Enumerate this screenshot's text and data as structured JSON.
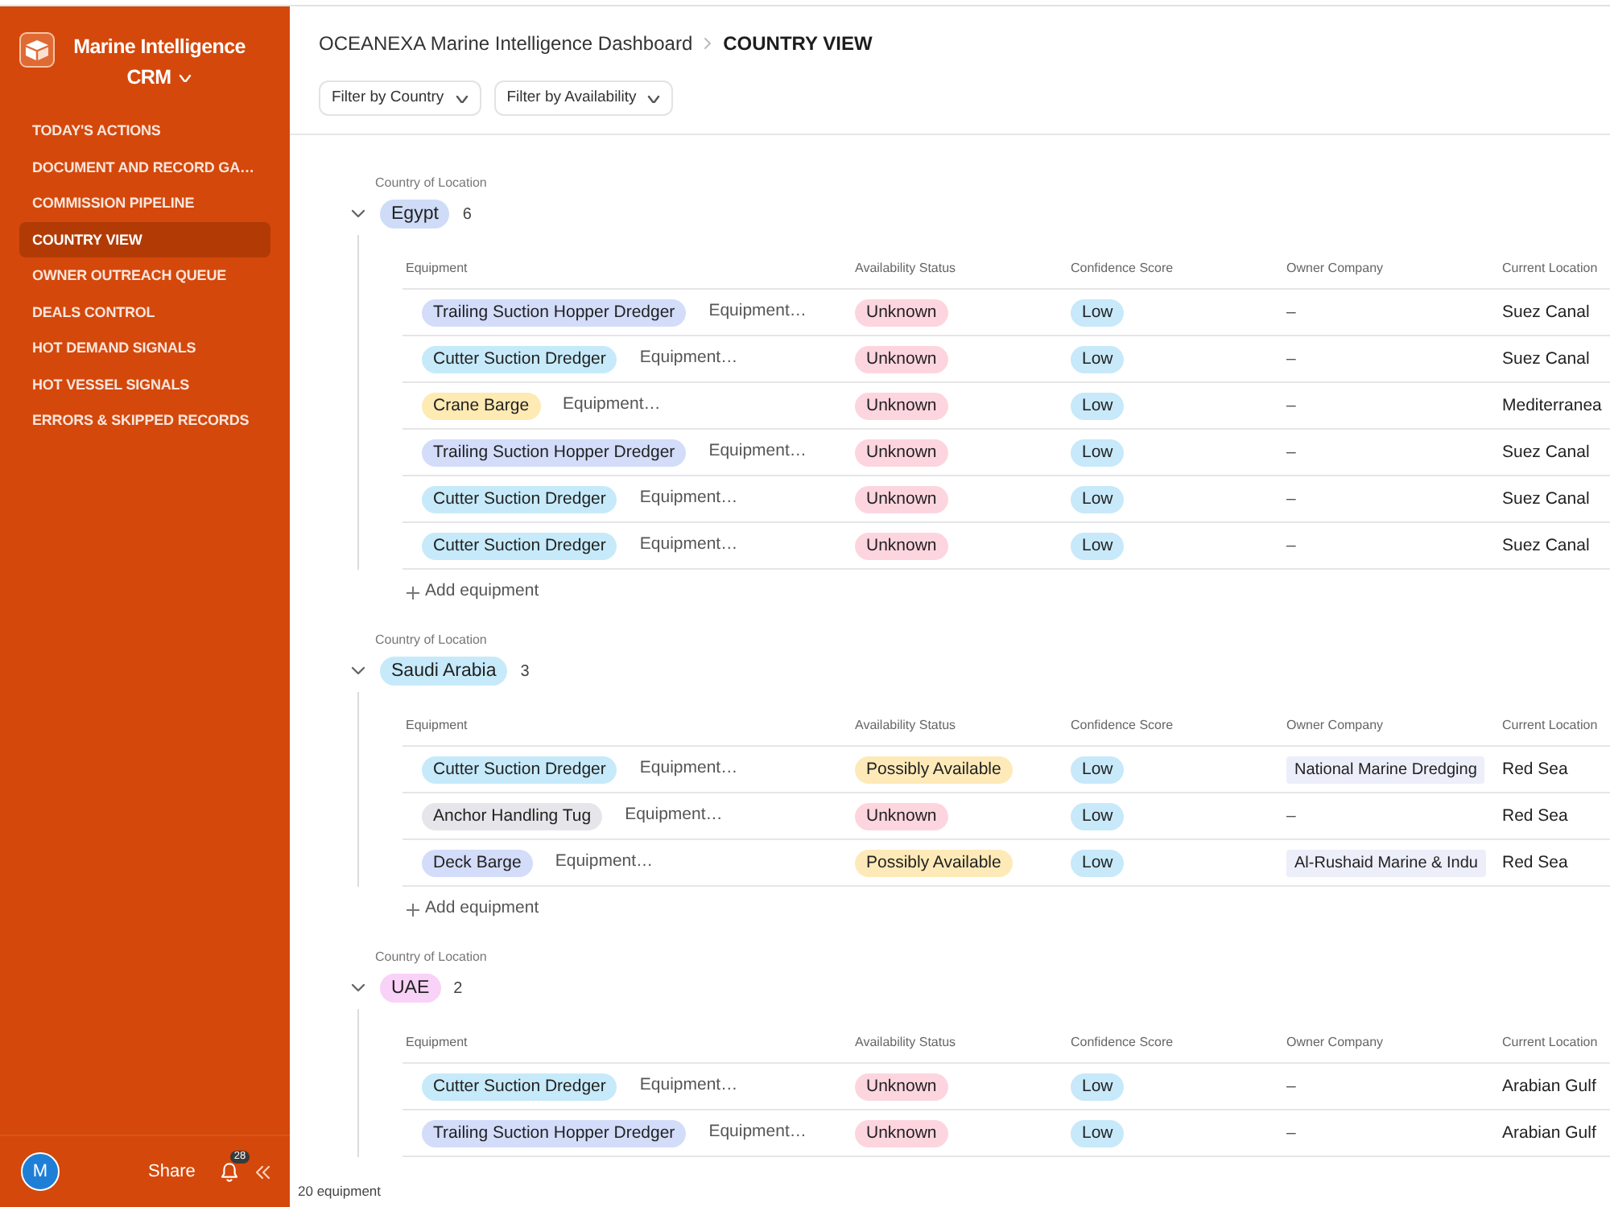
{
  "sidebar": {
    "app_title": "Marine Intelligence",
    "app_subtitle": "CRM",
    "items": [
      {
        "label": "TODAY'S ACTIONS",
        "selected": false
      },
      {
        "label": "DOCUMENT AND RECORD GA…",
        "selected": false
      },
      {
        "label": "COMMISSION PIPELINE",
        "selected": false
      },
      {
        "label": "COUNTRY VIEW",
        "selected": true
      },
      {
        "label": "OWNER OUTREACH QUEUE",
        "selected": false
      },
      {
        "label": "DEALS CONTROL",
        "selected": false
      },
      {
        "label": "HOT DEMAND SIGNALS",
        "selected": false
      },
      {
        "label": "HOT VESSEL SIGNALS",
        "selected": false
      },
      {
        "label": "ERRORS & SKIPPED RECORDS",
        "selected": false
      }
    ],
    "footer": {
      "avatar_initial": "M",
      "share_label": "Share",
      "notification_count": "28"
    }
  },
  "header": {
    "breadcrumb": [
      "OCEANEXA Marine Intelligence Dashboard",
      "COUNTRY VIEW"
    ],
    "filters": [
      "Filter by Country",
      "Filter by Availability"
    ]
  },
  "groups": [
    {
      "field_label": "Country of Location",
      "country": {
        "label": "Egypt",
        "color": "#cfdcf7"
      },
      "count": "6",
      "expanded": true,
      "columns": [
        "Equipment",
        "Availability Status",
        "Confidence Score",
        "Owner Company",
        "Current Location"
      ],
      "rows": [
        {
          "equipment_type": {
            "label": "Trailing Suction Hopper Dredger",
            "color": "#d3ddfa"
          },
          "equipment": "Equipment…",
          "availability": {
            "label": "Unknown",
            "color": "#fdd5df"
          },
          "confidence": {
            "label": "Low",
            "color": "#c7e9fa"
          },
          "owner_company": {
            "text": "–",
            "kind": "empty"
          },
          "current_location": "Suez Canal"
        },
        {
          "equipment_type": {
            "label": "Cutter Suction Dredger",
            "color": "#c6eafa"
          },
          "equipment": "Equipment…",
          "availability": {
            "label": "Unknown",
            "color": "#fdd5df"
          },
          "confidence": {
            "label": "Low",
            "color": "#c7e9fa"
          },
          "owner_company": {
            "text": "–",
            "kind": "empty"
          },
          "current_location": "Suez Canal"
        },
        {
          "equipment_type": {
            "label": "Crane Barge",
            "color": "#feeab3"
          },
          "equipment": "Equipment…",
          "availability": {
            "label": "Unknown",
            "color": "#fdd5df"
          },
          "confidence": {
            "label": "Low",
            "color": "#c7e9fa"
          },
          "owner_company": {
            "text": "–",
            "kind": "empty"
          },
          "current_location": "Mediterranea"
        },
        {
          "equipment_type": {
            "label": "Trailing Suction Hopper Dredger",
            "color": "#d3ddfa"
          },
          "equipment": "Equipment…",
          "availability": {
            "label": "Unknown",
            "color": "#fdd5df"
          },
          "confidence": {
            "label": "Low",
            "color": "#c7e9fa"
          },
          "owner_company": {
            "text": "–",
            "kind": "empty"
          },
          "current_location": "Suez Canal"
        },
        {
          "equipment_type": {
            "label": "Cutter Suction Dredger",
            "color": "#c6eafa"
          },
          "equipment": "Equipment…",
          "availability": {
            "label": "Unknown",
            "color": "#fdd5df"
          },
          "confidence": {
            "label": "Low",
            "color": "#c7e9fa"
          },
          "owner_company": {
            "text": "–",
            "kind": "empty"
          },
          "current_location": "Suez Canal"
        },
        {
          "equipment_type": {
            "label": "Cutter Suction Dredger",
            "color": "#c6eafa"
          },
          "equipment": "Equipment…",
          "availability": {
            "label": "Unknown",
            "color": "#fdd5df"
          },
          "confidence": {
            "label": "Low",
            "color": "#c7e9fa"
          },
          "owner_company": {
            "text": "–",
            "kind": "empty"
          },
          "current_location": "Suez Canal"
        }
      ],
      "add_label": "Add equipment"
    },
    {
      "field_label": "Country of Location",
      "country": {
        "label": "Saudi Arabia",
        "color": "#c6eafa"
      },
      "count": "3",
      "expanded": true,
      "columns": [
        "Equipment",
        "Availability Status",
        "Confidence Score",
        "Owner Company",
        "Current Location"
      ],
      "rows": [
        {
          "equipment_type": {
            "label": "Cutter Suction Dredger",
            "color": "#c6eafa"
          },
          "equipment": "Equipment…",
          "availability": {
            "label": "Possibly Available",
            "color": "#feeab8"
          },
          "confidence": {
            "label": "Low",
            "color": "#c7e9fa"
          },
          "owner_company": {
            "text": "National Marine Dredging",
            "kind": "link"
          },
          "current_location": "Red Sea"
        },
        {
          "equipment_type": {
            "label": "Anchor Handling Tug",
            "color": "#e6e6ea"
          },
          "equipment": "Equipment…",
          "availability": {
            "label": "Unknown",
            "color": "#fdd5df"
          },
          "confidence": {
            "label": "Low",
            "color": "#c7e9fa"
          },
          "owner_company": {
            "text": "–",
            "kind": "empty"
          },
          "current_location": "Red Sea"
        },
        {
          "equipment_type": {
            "label": "Deck Barge",
            "color": "#d3ddfa"
          },
          "equipment": "Equipment…",
          "availability": {
            "label": "Possibly Available",
            "color": "#feeab8"
          },
          "confidence": {
            "label": "Low",
            "color": "#c7e9fa"
          },
          "owner_company": {
            "text": "Al-Rushaid Marine & Indu",
            "kind": "link"
          },
          "current_location": "Red Sea"
        }
      ],
      "add_label": "Add equipment"
    },
    {
      "field_label": "Country of Location",
      "country": {
        "label": "UAE",
        "color": "#f9d2f7"
      },
      "count": "2",
      "expanded": true,
      "columns": [
        "Equipment",
        "Availability Status",
        "Confidence Score",
        "Owner Company",
        "Current Location"
      ],
      "rows": [
        {
          "equipment_type": {
            "label": "Cutter Suction Dredger",
            "color": "#c6eafa"
          },
          "equipment": "Equipment…",
          "availability": {
            "label": "Unknown",
            "color": "#fdd5df"
          },
          "confidence": {
            "label": "Low",
            "color": "#c7e9fa"
          },
          "owner_company": {
            "text": "–",
            "kind": "empty"
          },
          "current_location": "Arabian Gulf"
        },
        {
          "equipment_type": {
            "label": "Trailing Suction Hopper Dredger",
            "color": "#d3ddfa"
          },
          "equipment": "Equipment…",
          "availability": {
            "label": "Unknown",
            "color": "#fdd5df"
          },
          "confidence": {
            "label": "Low",
            "color": "#c7e9fa"
          },
          "owner_company": {
            "text": "–",
            "kind": "empty"
          },
          "current_location": "Arabian Gulf"
        }
      ]
    }
  ],
  "status_bar": {
    "record_count": "20 equipment"
  }
}
